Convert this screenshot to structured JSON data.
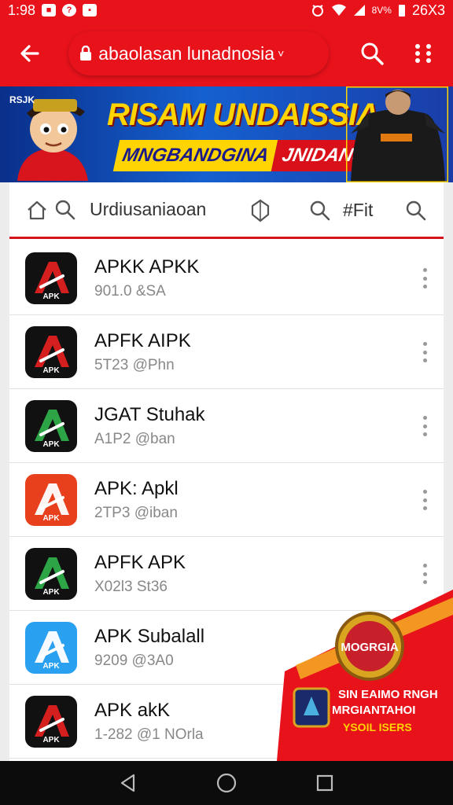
{
  "status_bar": {
    "time": "1:98",
    "icons_left": [
      "notification-icon",
      "help-icon",
      "message-icon"
    ],
    "battery_text": "26X3",
    "network_text": "8V%"
  },
  "app_bar": {
    "url": "abaolasan lunadnosia",
    "chevron": "˅"
  },
  "banner": {
    "brand": "RSJK",
    "headline": "RISAM UNDAISSIA",
    "tagline_yellow": "MNGBANDGINA",
    "tagline_red": "JNIDANSIAI"
  },
  "tab_bar": {
    "label": "Urdiusaniaoan",
    "filter_label": "#Fit"
  },
  "apps": [
    {
      "title": "APKK APKK",
      "meta": "901.0 &SA",
      "icon_bg": "#111111",
      "accent": "#e02020"
    },
    {
      "title": "APFK AIPK",
      "meta": "5T23 @Phn",
      "icon_bg": "#111111",
      "accent": "#e02020"
    },
    {
      "title": "JGAT Stuhak",
      "meta": "A1P2 @ban",
      "icon_bg": "#111111",
      "accent": "#2fae4a"
    },
    {
      "title": "APK: Apkl",
      "meta": "2TP3 @iban",
      "icon_bg": "#e8401c",
      "accent": "#ffffff"
    },
    {
      "title": "APFK APK",
      "meta": "X02l3 St36",
      "icon_bg": "#111111",
      "accent": "#2fae4a"
    },
    {
      "title": "APK Subalall",
      "meta": "9209 @3A0",
      "icon_bg": "#2aa0f0",
      "accent": "#ffffff"
    },
    {
      "title": "APK akK",
      "meta": "1-282 @1 NOrla",
      "icon_bg": "#111111",
      "accent": "#e02020"
    }
  ],
  "promo": {
    "badge": "MOGRGIA",
    "line1": "SIN EAIMO RNGH",
    "line2": "MRGIANTAHOI",
    "line3": "YSOIL ISERS"
  },
  "colors": {
    "primary": "#e8121b",
    "banner": "#1560d0",
    "accent_yellow": "#ffd400"
  }
}
